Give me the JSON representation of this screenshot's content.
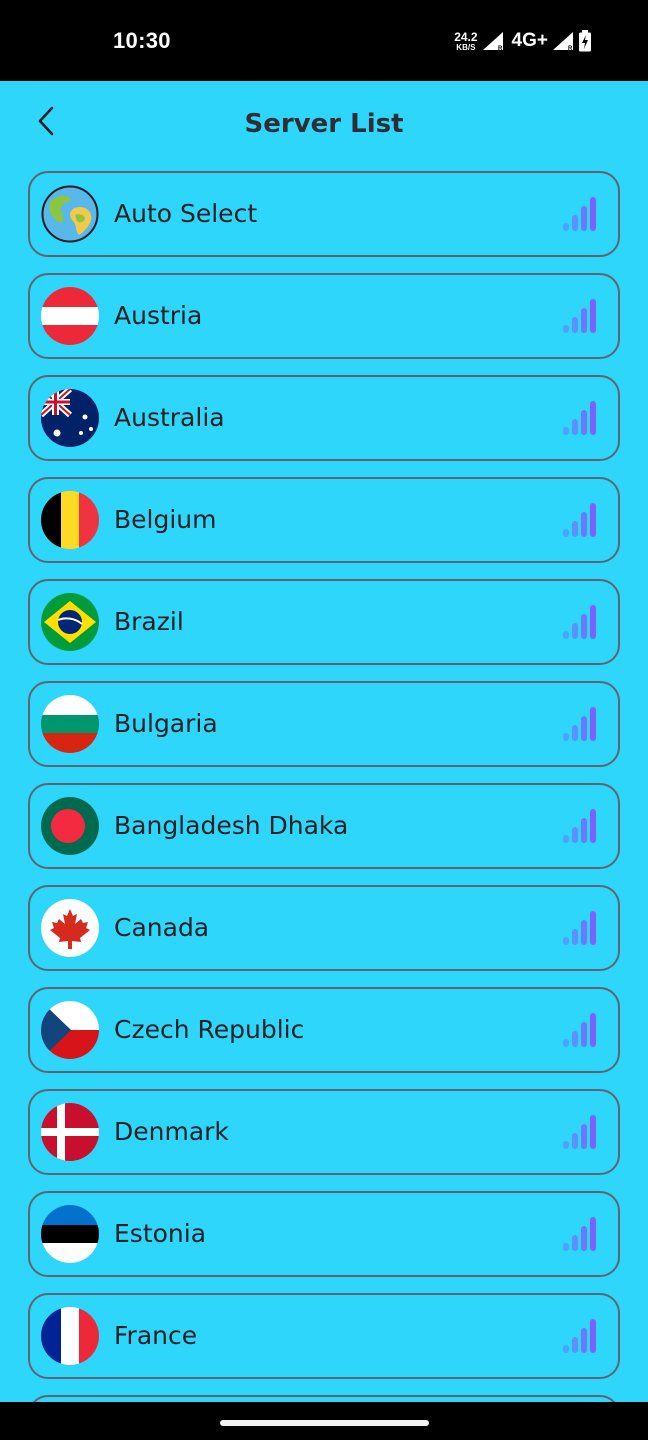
{
  "status_bar": {
    "time": "10:30",
    "net_speed_value": "24.2",
    "net_speed_unit": "KB/S",
    "network_type": "4G+",
    "signal_icon": "cell-signal-icon",
    "battery_icon": "battery-charging-icon"
  },
  "header": {
    "title": "Server List",
    "back_icon": "chevron-left-icon"
  },
  "colors": {
    "background": "#2ed6fb",
    "item_border": "#5d6670",
    "signal_bar": "#7b61ff"
  },
  "servers": [
    {
      "name": "Auto Select",
      "flag_icon": "globe-icon",
      "signal_icon": "signal-bars-icon"
    },
    {
      "name": "Austria",
      "flag_icon": "austria-flag-icon",
      "signal_icon": "signal-bars-icon"
    },
    {
      "name": "Australia",
      "flag_icon": "australia-flag-icon",
      "signal_icon": "signal-bars-icon"
    },
    {
      "name": "Belgium",
      "flag_icon": "belgium-flag-icon",
      "signal_icon": "signal-bars-icon"
    },
    {
      "name": " Brazil",
      "flag_icon": "brazil-flag-icon",
      "signal_icon": "signal-bars-icon"
    },
    {
      "name": "Bulgaria",
      "flag_icon": "bulgaria-flag-icon",
      "signal_icon": "signal-bars-icon"
    },
    {
      "name": "Bangladesh Dhaka",
      "flag_icon": "bangladesh-flag-icon",
      "signal_icon": "signal-bars-icon"
    },
    {
      "name": "Canada",
      "flag_icon": "canada-flag-icon",
      "signal_icon": "signal-bars-icon"
    },
    {
      "name": "Czech Republic",
      "flag_icon": "czech-flag-icon",
      "signal_icon": "signal-bars-icon"
    },
    {
      "name": "Denmark",
      "flag_icon": "denmark-flag-icon",
      "signal_icon": "signal-bars-icon"
    },
    {
      "name": "Estonia",
      "flag_icon": "estonia-flag-icon",
      "signal_icon": "signal-bars-icon"
    },
    {
      "name": "France",
      "flag_icon": "france-flag-icon",
      "signal_icon": "signal-bars-icon"
    },
    {
      "name": "",
      "flag_icon": "",
      "signal_icon": ""
    }
  ]
}
